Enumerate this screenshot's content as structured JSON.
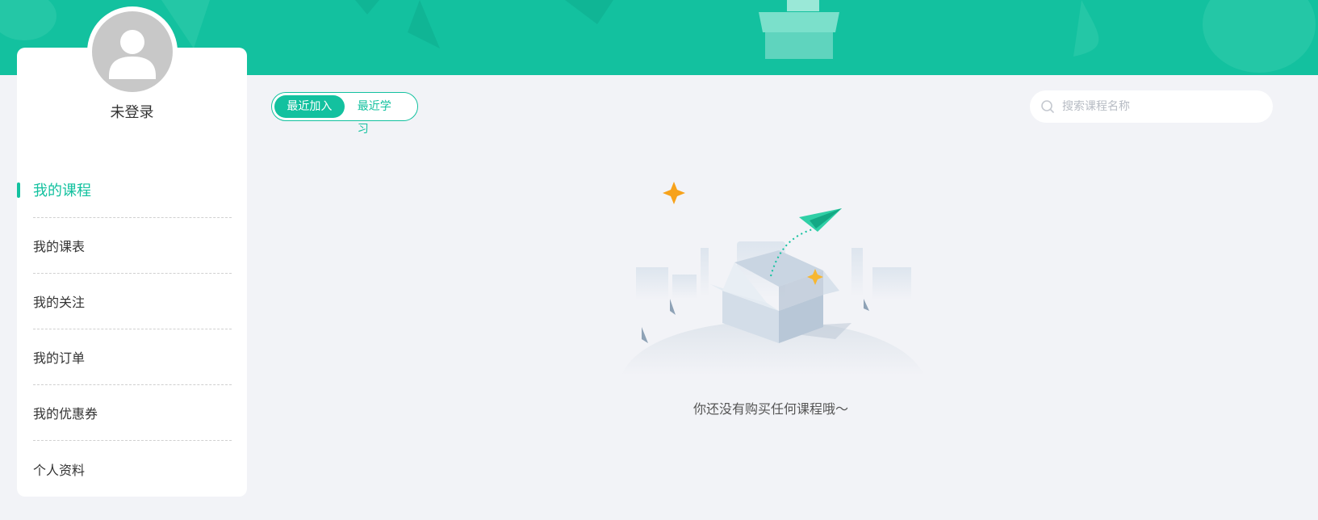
{
  "profile": {
    "login_status": "未登录"
  },
  "menu": {
    "items": [
      {
        "label": "我的课程",
        "active": true
      },
      {
        "label": "我的课表"
      },
      {
        "label": "我的关注"
      },
      {
        "label": "我的订单"
      },
      {
        "label": "我的优惠券"
      },
      {
        "label": "个人资料"
      }
    ]
  },
  "filter": {
    "recent_added": "最近加入",
    "recent_studied": "最近学习",
    "selected": "最近加入"
  },
  "search": {
    "placeholder": "搜索课程名称",
    "value": ""
  },
  "empty": {
    "message": "你还没有购买任何课程哦～"
  },
  "colors": {
    "accent": "#13c19f",
    "background": "#f2f3f7"
  },
  "icons": {
    "avatar": "user-avatar-icon",
    "search": "search-icon",
    "empty": "empty-box-illustration"
  }
}
